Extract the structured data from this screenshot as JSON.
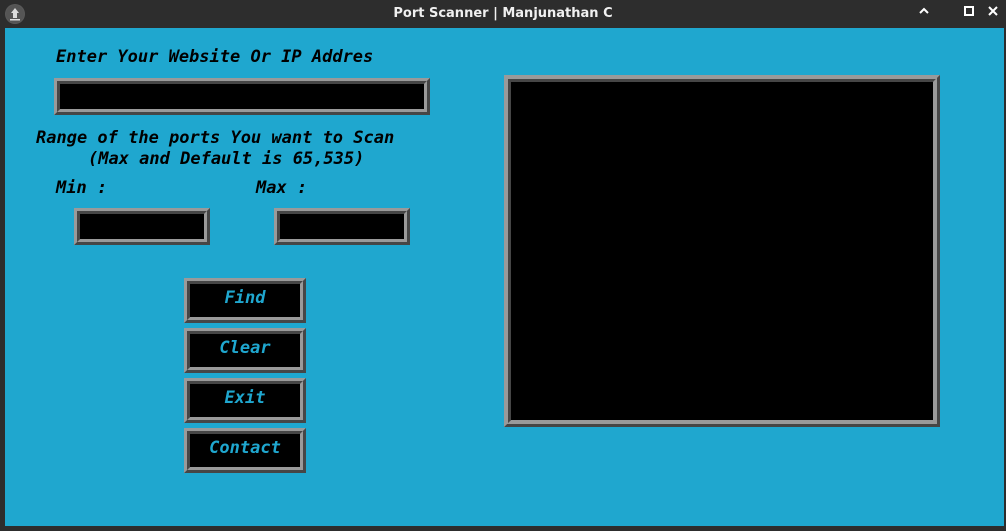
{
  "window": {
    "title": "Port Scanner | Manjunathan C",
    "controls": {
      "minimize": "^",
      "maximize": "□",
      "close": "✕"
    }
  },
  "form": {
    "website_label": "Enter Your Website Or IP Addres",
    "website_value": "",
    "range_label_line1": "Range of the ports You want to Scan",
    "range_label_line2": "(Max and Default is 65,535)",
    "min_label": "Min :",
    "min_value": "",
    "max_label": "Max :",
    "max_value": ""
  },
  "buttons": {
    "find": "Find",
    "clear": "Clear",
    "exit": "Exit",
    "contact": "Contact"
  },
  "colors": {
    "background": "#1fa7cf",
    "button_text": "#1fa7cf",
    "field_bg": "#000000"
  }
}
